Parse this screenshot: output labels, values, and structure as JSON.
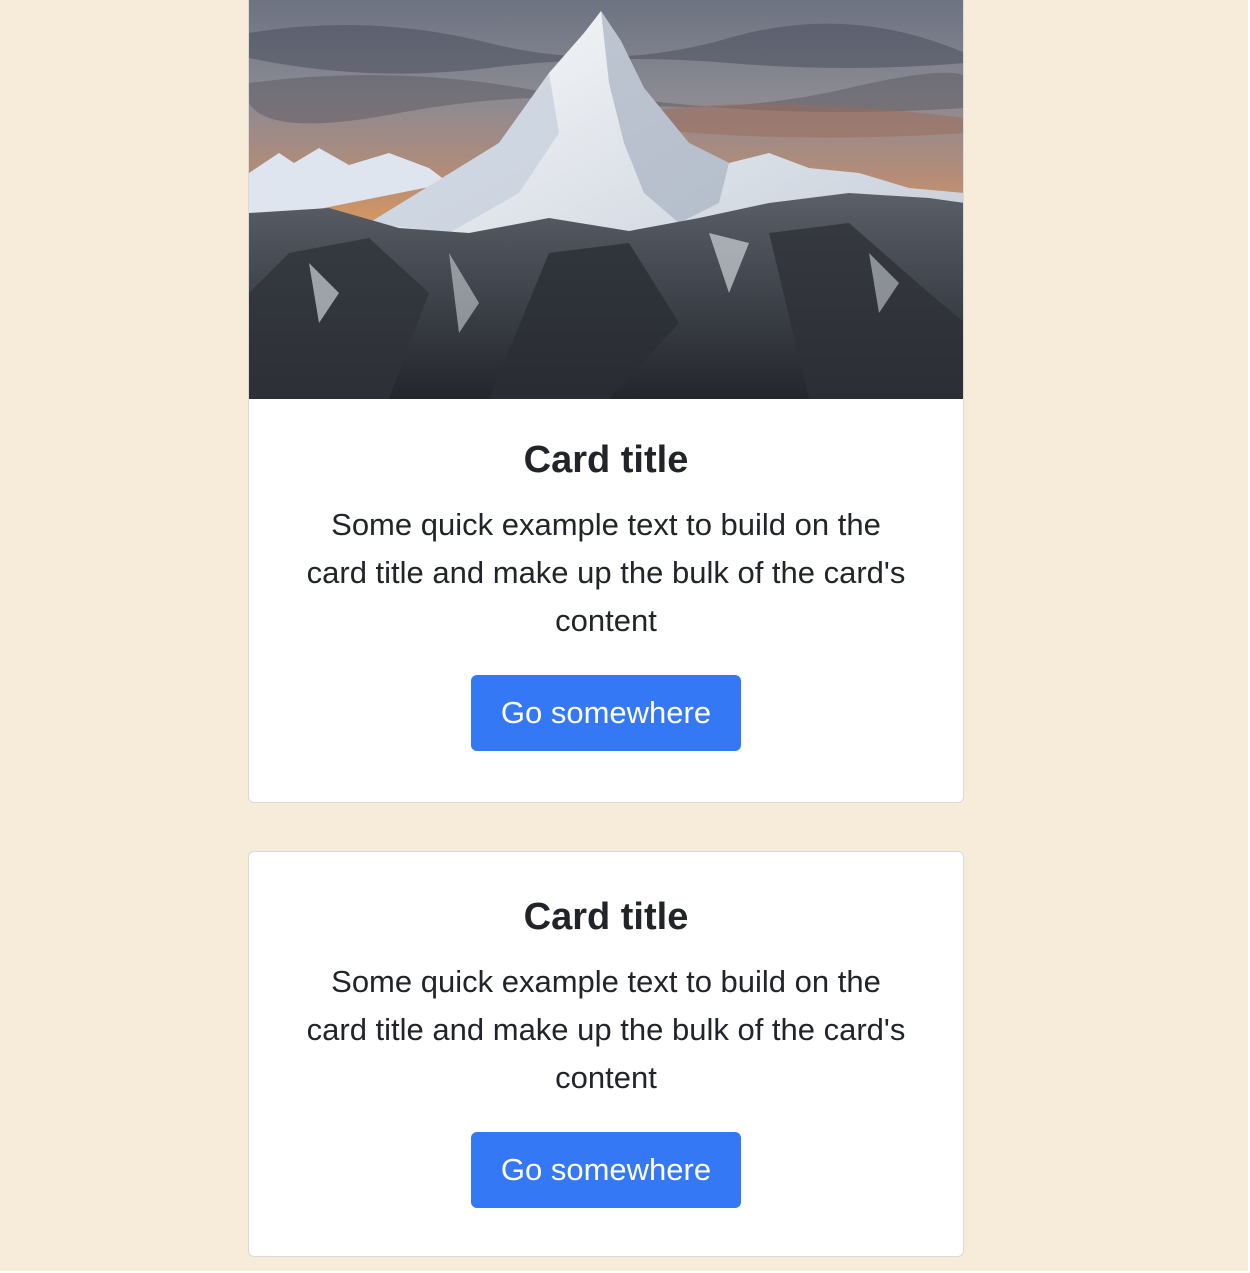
{
  "page": {
    "background_color": "#f7ebda"
  },
  "colors": {
    "card_background": "#ffffff",
    "primary_button": "#3478f6",
    "text": "#212529"
  },
  "cards": [
    {
      "image": {
        "subject": "snow-capped-mountain-peak-at-sunset"
      },
      "title": "Card title",
      "text": "Some quick example text to build on the card title and make up the bulk of the card's content",
      "button_label": "Go somewhere"
    },
    {
      "title": "Card title",
      "text": "Some quick example text to build on the card title and make up the bulk of the card's content",
      "button_label": "Go somewhere"
    }
  ]
}
